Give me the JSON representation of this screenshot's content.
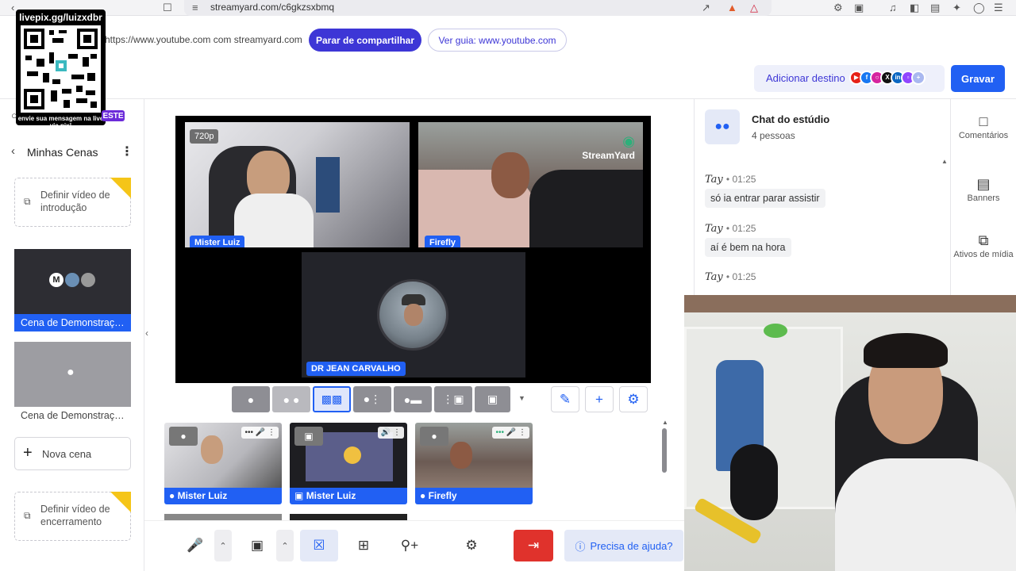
{
  "browser": {
    "url": "streamyard.com/c6gkzsxbmq"
  },
  "share_bar": {
    "sharing_text": "https://www.youtube.com com streamyard.com",
    "stop_label": "Parar de compartilhar",
    "guide_label": "Ver guia: www.youtube.com"
  },
  "header": {
    "add_destination_label": "Adicionar destino",
    "record_label": "Gravar",
    "destination_icons": [
      "youtube-icon",
      "facebook-icon",
      "instagram-icon",
      "x-icon",
      "linkedin-icon",
      "twitch-icon",
      "plus-icon"
    ]
  },
  "overlay": {
    "qr_title": "livepix.gg/luizxdbr",
    "qr_caption": "envie sua mensagem na live via pix!",
    "badge": "ESTE"
  },
  "sidebar": {
    "title": "Minhas Cenas",
    "intro_label": "Definir vídeo de introdução",
    "scenes": [
      {
        "label": "Cena de Demonstraç…",
        "active": true
      },
      {
        "label": "Cena de Demonstraç…",
        "active": false
      }
    ],
    "new_scene_label": "Nova cena",
    "outro_label": "Definir vídeo de encerramento"
  },
  "stage": {
    "resolution": "720p",
    "participants": [
      {
        "name": "Mister Luiz"
      },
      {
        "name": "Firefly"
      },
      {
        "name": "DR JEAN CARVALHO"
      }
    ],
    "watermark": "StreamYard"
  },
  "backstage": {
    "items": [
      {
        "name": "Mister Luiz"
      },
      {
        "name": "Mister Luiz"
      },
      {
        "name": "Firefly"
      }
    ]
  },
  "bottom_bar": {
    "help_label": "Precisa de ajuda?"
  },
  "chat": {
    "title": "Chat do estúdio",
    "subtitle": "4 pessoas",
    "messages": [
      {
        "author": "Tay",
        "time": "01:25",
        "text": "só ia entrar parar assistir"
      },
      {
        "author": "Tay",
        "time": "01:25",
        "text": "aí é bem na hora"
      },
      {
        "author": "Tay",
        "time": "01:25",
        "text": ""
      }
    ]
  },
  "right_rail": {
    "items": [
      {
        "label": "Comentários",
        "icon": "comment-icon"
      },
      {
        "label": "Banners",
        "icon": "banner-icon"
      },
      {
        "label": "Ativos de mídia",
        "icon": "media-icon"
      }
    ]
  }
}
